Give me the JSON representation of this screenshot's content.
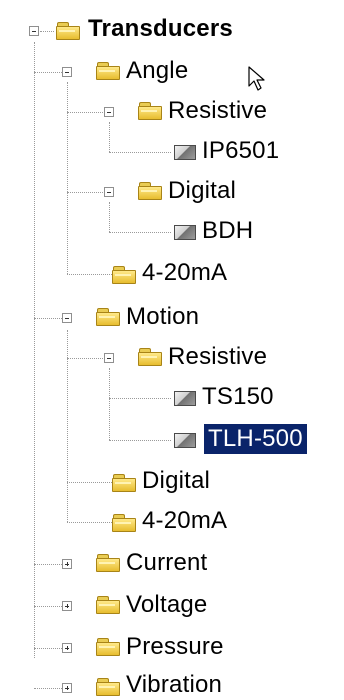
{
  "tree": {
    "root": {
      "label": "Transducers",
      "type": "folder",
      "expanded": true
    },
    "items": [
      {
        "label": "Angle",
        "type": "folder",
        "expanded": true
      },
      {
        "label": "Resistive",
        "type": "folder",
        "expanded": true
      },
      {
        "label": "IP6501",
        "type": "device"
      },
      {
        "label": "Digital",
        "type": "folder",
        "expanded": true
      },
      {
        "label": "BDH",
        "type": "device"
      },
      {
        "label": "4-20mA",
        "type": "folder"
      },
      {
        "label": "Motion",
        "type": "folder",
        "expanded": true
      },
      {
        "label": "Resistive",
        "type": "folder",
        "expanded": true
      },
      {
        "label": "TS150",
        "type": "device"
      },
      {
        "label": "TLH-500",
        "type": "device",
        "selected": true
      },
      {
        "label": "Digital",
        "type": "folder"
      },
      {
        "label": "4-20mA",
        "type": "folder"
      },
      {
        "label": "Current",
        "type": "folder",
        "expanded": false
      },
      {
        "label": "Voltage",
        "type": "folder",
        "expanded": false
      },
      {
        "label": "Pressure",
        "type": "folder",
        "expanded": false
      },
      {
        "label": "Vibration",
        "type": "folder",
        "expanded": false
      }
    ]
  },
  "colors": {
    "selection": "#0a246a",
    "folder": "#e7bd2f",
    "connector": "#9a9a9a"
  }
}
